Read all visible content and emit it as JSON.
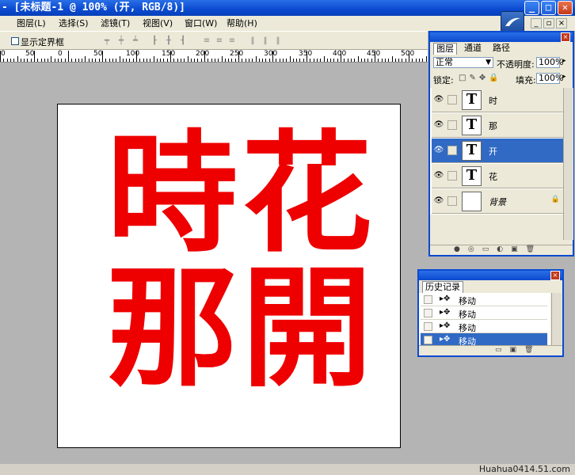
{
  "titlebar": {
    "title": "- [未标题-1 @ 100% (开, RGB/8)]",
    "min": "_",
    "max": "□",
    "close": "✕"
  },
  "menu": [
    "图层(L)",
    "选择(S)",
    "滤镜(T)",
    "视图(V)",
    "窗口(W)",
    "帮助(H)"
  ],
  "options": {
    "show_bounds_label": "显示定界框"
  },
  "ruler": {
    "labels": [
      "0",
      "50",
      "0",
      "50",
      "100",
      "150",
      "200",
      "250",
      "300",
      "350",
      "400",
      "450",
      "500"
    ]
  },
  "canvas": {
    "chars": [
      "時",
      "花",
      "那",
      "開"
    ]
  },
  "layers_panel": {
    "tabs": [
      "图层",
      "通道",
      "路径"
    ],
    "blend_mode": "正常",
    "opacity_label": "不透明度:",
    "opacity_value": "100%",
    "lock_label": "锁定:",
    "fill_label": "填充:",
    "fill_value": "100%",
    "layers": [
      {
        "name": "时",
        "thumb": "T",
        "selected": false
      },
      {
        "name": "那",
        "thumb": "T",
        "selected": false
      },
      {
        "name": "开",
        "thumb": "T",
        "selected": true
      },
      {
        "name": "花",
        "thumb": "T",
        "selected": false
      },
      {
        "name": "背景",
        "thumb": "",
        "selected": false
      }
    ]
  },
  "history_panel": {
    "title": "历史记录",
    "items": [
      {
        "label": "移动",
        "selected": false
      },
      {
        "label": "移动",
        "selected": false
      },
      {
        "label": "移动",
        "selected": false
      },
      {
        "label": "移动",
        "selected": true
      }
    ]
  },
  "footer": {
    "text": "Huahua0414.51.com"
  },
  "colors": {
    "accent": "#0a4ad0",
    "selected": "#316ac5",
    "glyph": "#ee0000"
  }
}
